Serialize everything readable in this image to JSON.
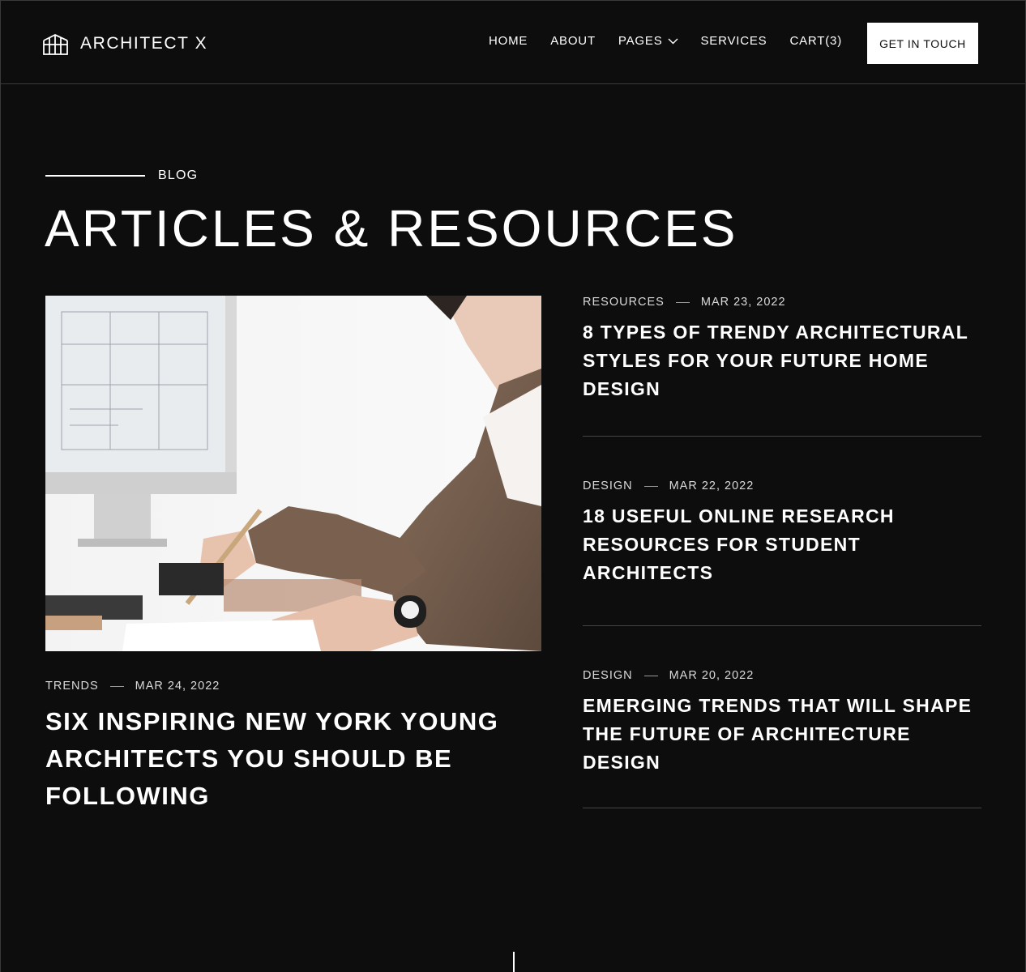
{
  "header": {
    "logo_text": "ARCHITECT X",
    "logo_icon": "building-icon",
    "nav": [
      {
        "label": "HOME"
      },
      {
        "label": "ABOUT"
      },
      {
        "label": "PAGES",
        "has_dropdown": true
      },
      {
        "label": "SERVICES"
      },
      {
        "label": "CART(3)"
      }
    ],
    "cta_label": "GET IN TOUCH"
  },
  "section": {
    "eyebrow": "BLOG",
    "title": "ARTICLES & RESOURCES"
  },
  "featured": {
    "category": "TRENDS",
    "date": "MAR 24, 2022",
    "title": "SIX INSPIRING NEW YORK YOUNG ARCHITECTS YOU SHOULD BE FOLLOWING",
    "image": "person-sketching-at-computer-photo"
  },
  "posts": [
    {
      "category": "RESOURCES",
      "date": "MAR 23, 2022",
      "title": "8 TYPES OF TRENDY ARCHITECTURAL STYLES FOR YOUR FUTURE HOME DESIGN"
    },
    {
      "category": "DESIGN",
      "date": "MAR 22, 2022",
      "title": "18 USEFUL ONLINE RESEARCH RESOURCES FOR STUDENT ARCHITECTS"
    },
    {
      "category": "DESIGN",
      "date": "MAR 20, 2022",
      "title": "EMERGING TRENDS THAT WILL SHAPE THE FUTURE OF ARCHITECTURE DESIGN"
    }
  ],
  "colors": {
    "background": "#0e0d0d",
    "text": "#ffffff",
    "divider": "#444444",
    "cta_background": "#ffffff"
  }
}
